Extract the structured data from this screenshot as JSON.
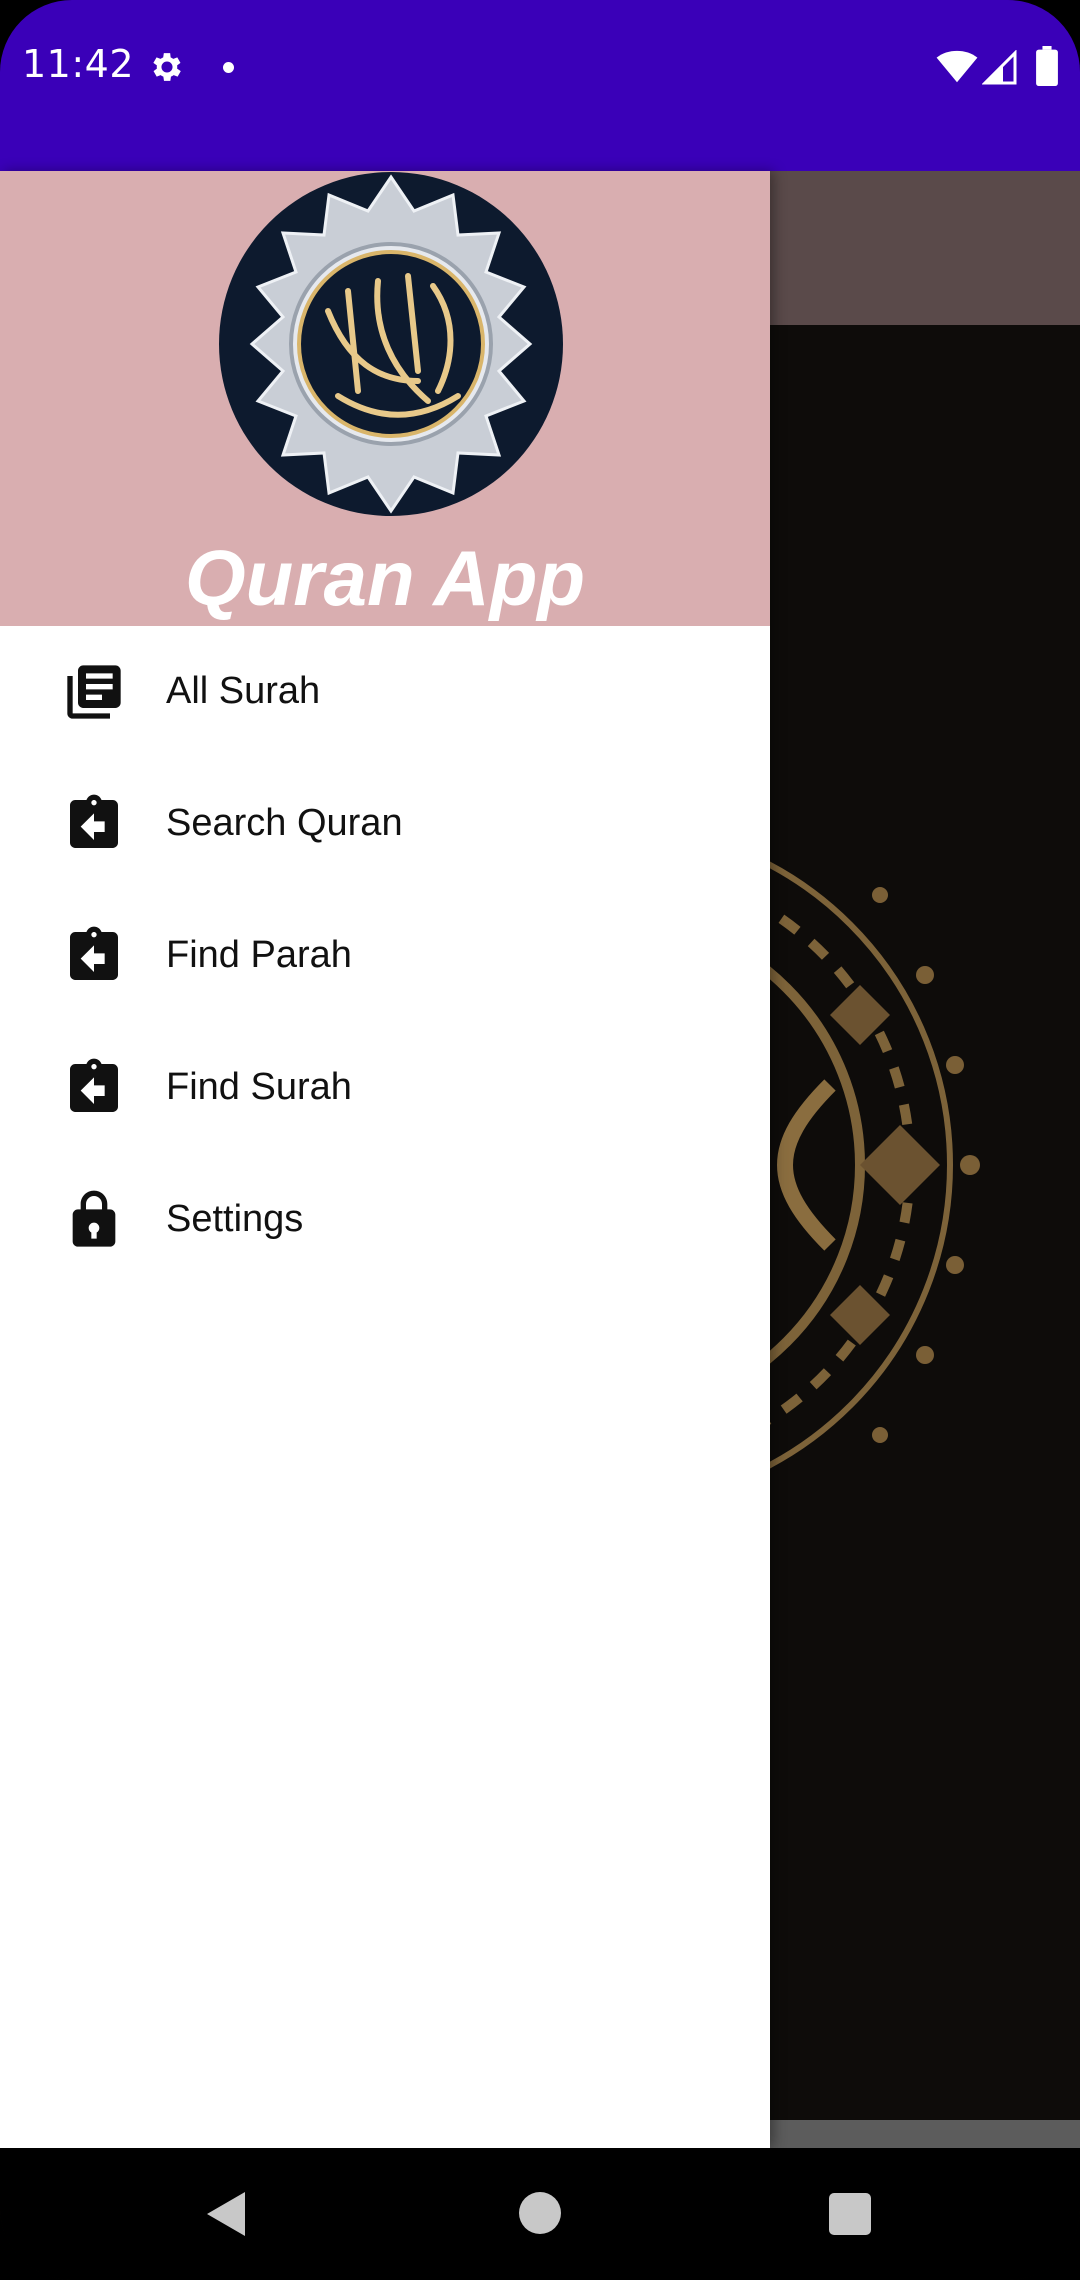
{
  "status_bar": {
    "time": "11:42",
    "icons": [
      "gear-icon",
      "dot-icon",
      "wifi-icon",
      "signal-icon",
      "battery-icon"
    ],
    "background": "#3a00b8"
  },
  "drawer": {
    "header": {
      "title": "Quran App",
      "background": "#d9aeb0",
      "logo": "quran-logo"
    },
    "items": [
      {
        "label": "All Surah",
        "icon": "library-books-icon"
      },
      {
        "label": "Search Quran",
        "icon": "assignment-return-icon"
      },
      {
        "label": "Find Parah",
        "icon": "assignment-return-icon"
      },
      {
        "label": "Find Surah",
        "icon": "assignment-return-icon"
      },
      {
        "label": "Settings",
        "icon": "lock-icon"
      }
    ]
  },
  "navigation_bar": {
    "buttons": [
      "back-icon",
      "home-icon",
      "recents-icon"
    ]
  }
}
